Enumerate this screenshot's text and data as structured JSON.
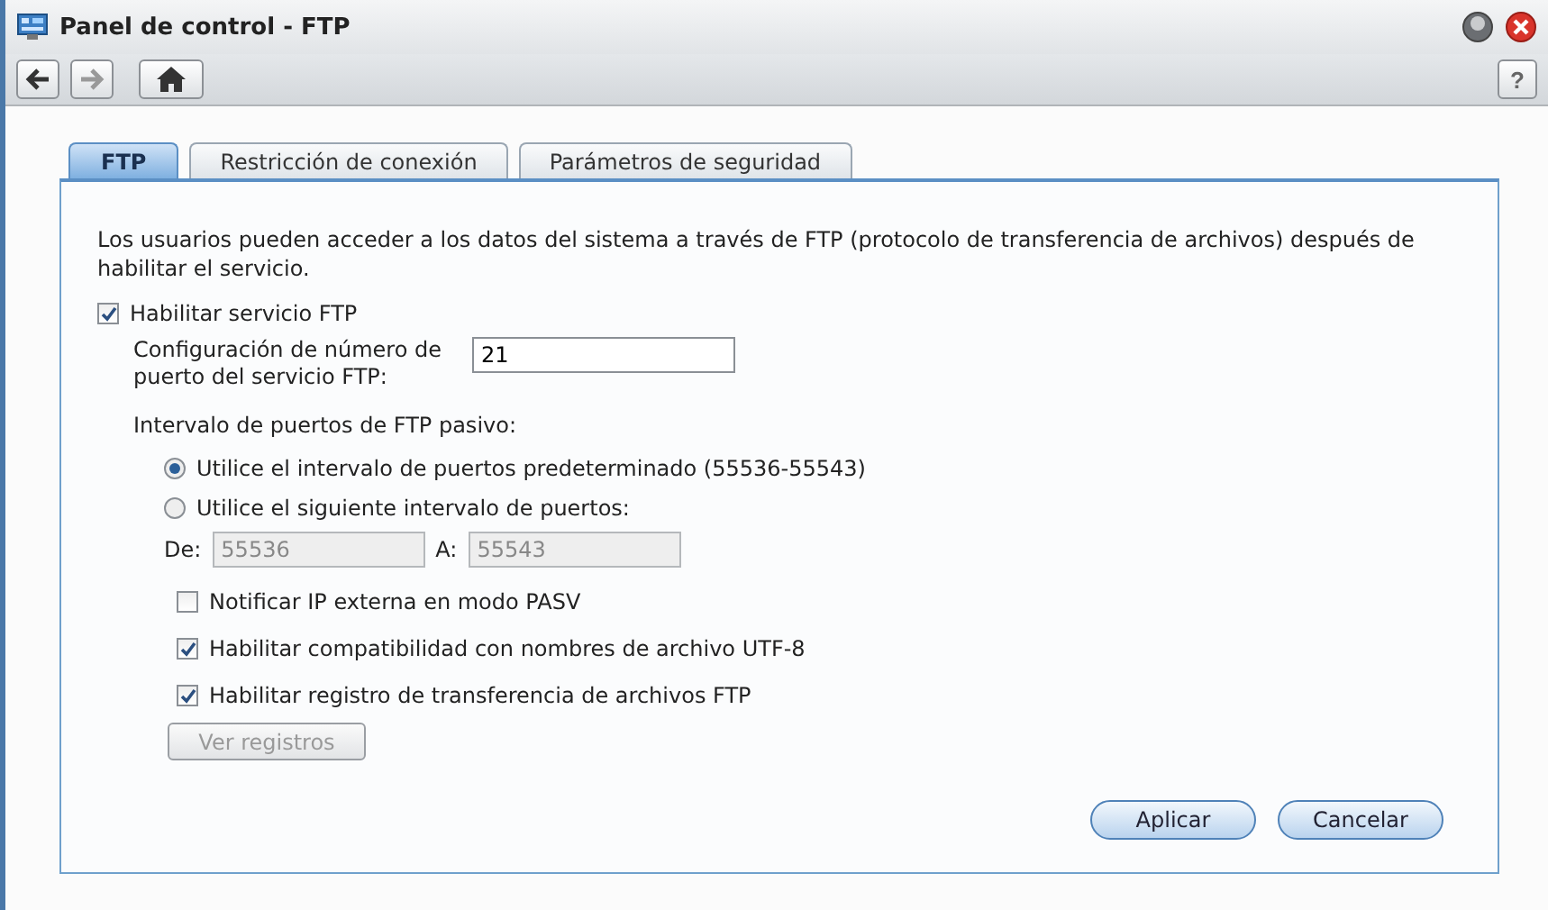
{
  "window": {
    "title": "Panel de control - FTP"
  },
  "toolbar": {
    "buttons": [
      {
        "kind": "back",
        "disabled": false
      },
      {
        "kind": "forward",
        "disabled": true
      },
      {
        "kind": "home",
        "disabled": false
      }
    ],
    "help": "?"
  },
  "tabs": [
    {
      "label": "FTP",
      "selected": true
    },
    {
      "label": "Restricción de conexión",
      "selected": false
    },
    {
      "label": "Parámetros de seguridad",
      "selected": false
    }
  ],
  "description": "Los usuarios pueden acceder a los datos del sistema a través de FTP (protocolo de transferencia de archivos) después de habilitar el servicio.",
  "enable_ftp": {
    "label": "Habilitar servicio FTP",
    "checked": true
  },
  "port": {
    "label": "Configuración de número de puerto del servicio FTP:",
    "value": "21"
  },
  "passive": {
    "label": "Intervalo de puertos de FTP pasivo:",
    "options": [
      {
        "label": "Utilice el intervalo de puertos predeterminado (55536-55543)",
        "selected": true
      },
      {
        "label": "Utilice el siguiente intervalo de puertos:",
        "selected": false
      }
    ],
    "range": [
      {
        "label": "De:",
        "value": "55536",
        "disabled": true
      },
      {
        "label": "A:",
        "value": "55543",
        "disabled": true
      }
    ]
  },
  "options": [
    {
      "label": "Notificar IP externa en modo PASV",
      "checked": false
    },
    {
      "label": "Habilitar compatibilidad con nombres de archivo UTF-8",
      "checked": true
    },
    {
      "label": "Habilitar registro de transferencia de archivos FTP",
      "checked": true
    }
  ],
  "log_button": {
    "label": "Ver registros",
    "disabled": true
  },
  "buttons": [
    "Aplicar",
    "Cancelar"
  ]
}
